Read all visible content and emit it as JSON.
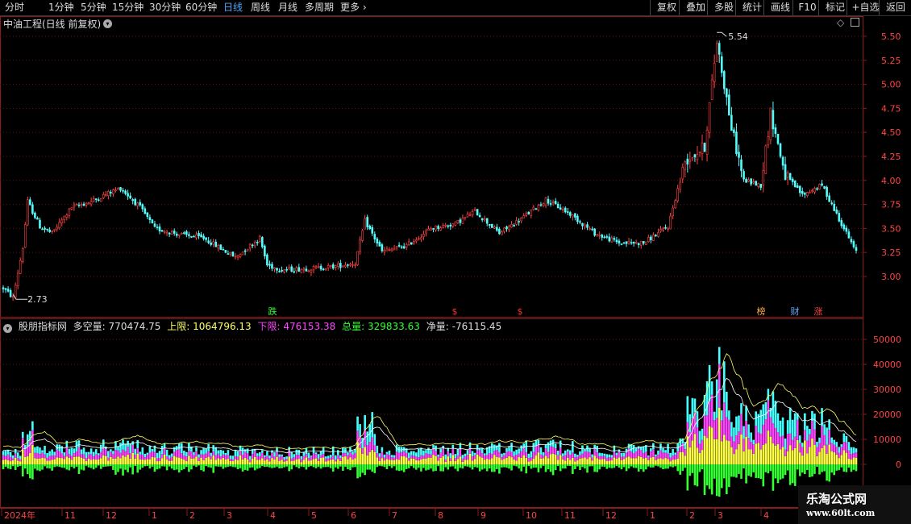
{
  "toolbar": {
    "periods": [
      "分时",
      "1分钟",
      "5分钟",
      "15分钟",
      "30分钟",
      "60分钟",
      "日线",
      "周线",
      "月线",
      "多周期",
      "更多"
    ],
    "active_period": "日线",
    "more_chevron": "›",
    "right_buttons": [
      "复权",
      "叠加",
      "多股",
      "统计",
      "画线",
      "F10",
      "标记",
      "+自选",
      "返回"
    ]
  },
  "main_chart": {
    "title": "中油工程(日线 前复权)",
    "price_axis_labels": [
      "5.50",
      "5.25",
      "5.00",
      "4.75",
      "4.50",
      "4.25",
      "4.00",
      "3.75",
      "3.50",
      "3.25",
      "3.00"
    ],
    "high_marker": "5.54",
    "low_marker": "2.73",
    "event_markers": [
      {
        "text": "跌",
        "color": "#33ff33"
      },
      {
        "text": "$",
        "color": "#ff3333"
      },
      {
        "text": "$",
        "color": "#ff3333"
      },
      {
        "text": "榜",
        "color": "#ffaa44"
      },
      {
        "text": "财",
        "color": "#66aaff"
      },
      {
        "text": "涨",
        "color": "#ff4444"
      }
    ],
    "up_color": "#ff4444",
    "down_color": "#54fcfc"
  },
  "indicator": {
    "name": "股朋指标网",
    "fields": [
      {
        "label": "多空量:",
        "value": "770474.75",
        "color": "#dddddd"
      },
      {
        "label": "上限:",
        "value": "1064796.13",
        "color": "#ffff66"
      },
      {
        "label": "下限:",
        "value": "476153.38",
        "color": "#ff44ff"
      },
      {
        "label": "总量:",
        "value": "329833.63",
        "color": "#33ff33"
      },
      {
        "label": "净量:",
        "value": "-76115.45",
        "color": "#dddddd"
      }
    ],
    "axis_labels": [
      "50000",
      "40000",
      "30000",
      "20000",
      "10000",
      "0"
    ]
  },
  "date_axis": [
    "2024年",
    "11",
    "12",
    "1",
    "2",
    "3",
    "4",
    "5",
    "6",
    "7",
    "8",
    "9",
    "10",
    "11",
    "12",
    "1",
    "2",
    "3",
    "4"
  ],
  "watermark": {
    "line1": "乐淘公式网",
    "line2": "www.60lt.com"
  }
}
